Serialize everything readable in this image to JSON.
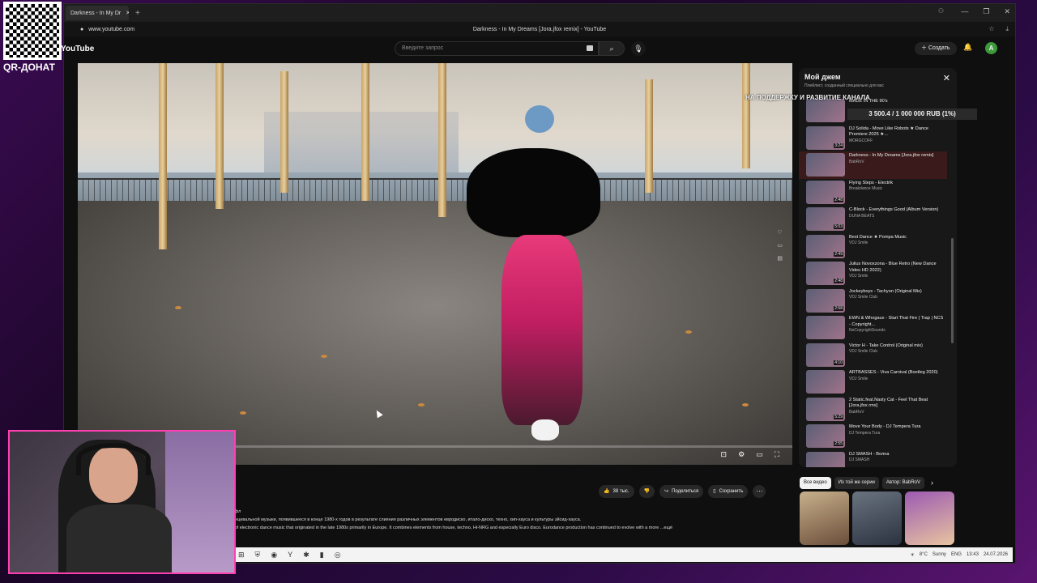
{
  "browser": {
    "tab_label": "Darkness - In My Dr",
    "new_tab": "+",
    "url": "www.youtube.com",
    "page_title": "Darkness - In My Dreams [Jora.jfox remix] - YouTube"
  },
  "youtube": {
    "logo": "YouTube",
    "search_placeholder": "Введите запрос",
    "create_label": "Создать",
    "avatar_letter": "A"
  },
  "player": {
    "progress": 0.2
  },
  "playlist": {
    "title": "Мой джем",
    "subtitle": "Плейлист, созданный специально для вас",
    "items": [
      {
        "title": "MADE IN THE 90's",
        "channel": "",
        "duration": ""
      },
      {
        "title": "DJ Solida - Move Like Robots ★ Dance Premiere 2025 ★...",
        "channel": "MORGCOFF",
        "duration": "3:24"
      },
      {
        "title": "Darkness - In My Dreams [Jora.jfox remix]",
        "channel": "BabRoV",
        "duration": "",
        "active": true
      },
      {
        "title": "Flying Steps - Electrik",
        "channel": "Breakdance Music",
        "duration": "2:48"
      },
      {
        "title": "C-Block - Everythings Good (Album Version)",
        "channel": "DUNA BEATS",
        "duration": "5:03"
      },
      {
        "title": "Best Dance ★ Pompa Music",
        "channel": "VDJ Smile",
        "duration": "2:49"
      },
      {
        "title": "Julius Novoxzona - Blue Retro (New Dance Video HD 2022)",
        "channel": "VDJ Smile",
        "duration": "2:48"
      },
      {
        "title": "Jockeyboys - Tachyon (Original Mix)",
        "channel": "VDJ Smile Club",
        "duration": "2:58"
      },
      {
        "title": "EWN & Whogaux - Start That Fire | Trap | NCS - Copyright...",
        "channel": "NoCopyrightSounds",
        "duration": ""
      },
      {
        "title": "Victor H - Take Control (Original mix)",
        "channel": "VDJ Smile Club",
        "duration": "4:10"
      },
      {
        "title": "ARTBASSES - Viva Carnival (Bootleg 2020)",
        "channel": "VDJ Smile",
        "duration": ""
      },
      {
        "title": "2 Static.feat.Nasty Cat - Feel That Beat [Jora.jfox rmx]",
        "channel": "BabRoV",
        "duration": "5:29"
      },
      {
        "title": "Move Your Body - DJ Tempera Tura",
        "channel": "DJ Tempera Tura",
        "duration": "2:55"
      },
      {
        "title": "DJ SMASH - Волна",
        "channel": "DJ SMASH",
        "duration": ""
      }
    ]
  },
  "overlay": {
    "donation_title": "НА ПОДДЕРЖКУ И РАЗВИТИЕ КАНАЛА",
    "donation_progress": "3 500.4 / 1 000 000 RUB (1%)",
    "qr_label": "QR-ДОНАТ"
  },
  "actions": {
    "likes": "38 тыс.",
    "share": "Поделиться",
    "save": "Сохранить"
  },
  "description": {
    "tag": "#Шаффл",
    "line_ru": "ной танцевальной музыки, появившееся в конце 1980-х годов в результате слияния различных элементов евродиско, итало-диско, техно, хип-хауса и культуры эйсид-хауса.",
    "line_en": "genre of electronic dance music that originated in the late 1980s primarily in Europe. It combines elements from house, techno, Hi-NRG and especially Euro disco. Eurodance production has continued to evolve with a more",
    "more": "...ещё"
  },
  "chips": [
    "Все видео",
    "Из той же серии",
    "Автор: BabRoV"
  ],
  "taskbar": {
    "weather": "8°C",
    "weather_desc": "Sunny",
    "lang": "ENG",
    "time": "13:43",
    "date": "24.07.2026"
  }
}
